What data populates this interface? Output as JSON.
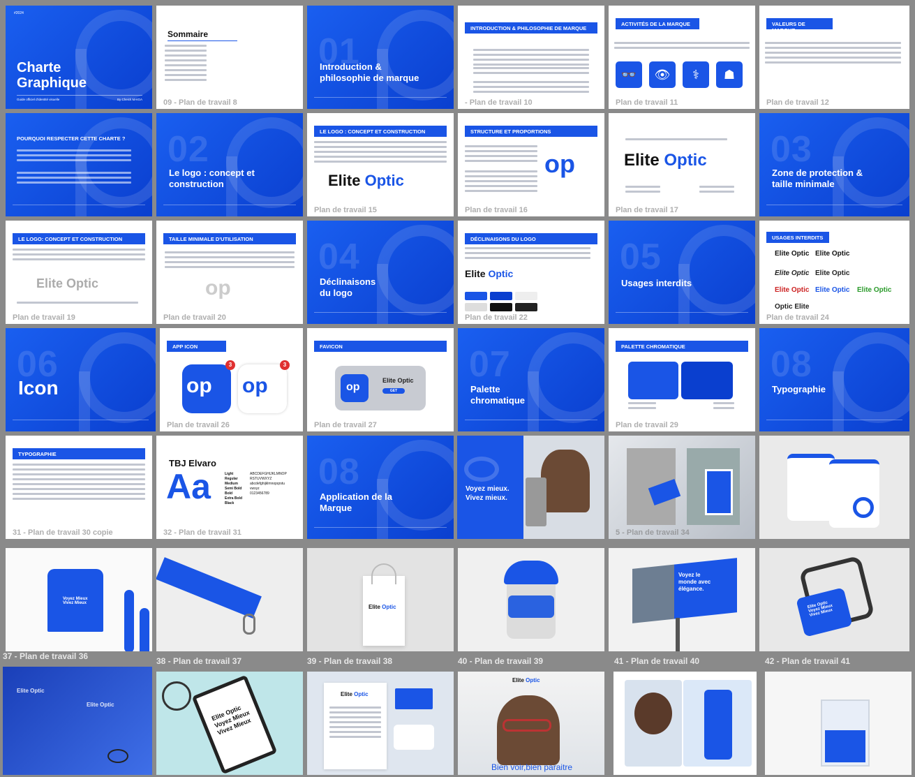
{
  "colors": {
    "canvas": "#8a8a8a",
    "brand_blue": "#1a55e6",
    "brand_dark": "#0a3fcf"
  },
  "brand": {
    "name_part1": "Elite ",
    "name_op": "Optic"
  },
  "b1": {
    "tag": "#2024",
    "title": "Charte\nGraphique",
    "sub": "Guide officiel d'identité visuelle",
    "author": "By Cheick MAIGA"
  },
  "b2": {
    "heading": "Sommaire",
    "label": "09 - Plan de travail 8"
  },
  "b3": {
    "num": "01",
    "title": "Introduction &\nphilosophie de marque"
  },
  "b4": {
    "bar": "INTRODUCTION & PHILOSOPHIE DE MARQUE",
    "label": "- Plan de travail 10"
  },
  "b5": {
    "bar": "ACTIVITÉS DE LA MARQUE",
    "label": "Plan de travail 11"
  },
  "b6": {
    "bar": "VALEURS DE MARQUE",
    "label": "Plan de travail 12"
  },
  "b7": {
    "bar": "POURQUOI RESPECTER CETTE CHARTE ?"
  },
  "b8": {
    "num": "02",
    "title": "Le logo : concept et\nconstruction"
  },
  "b9": {
    "bar": "LE LOGO : CONCEPT ET CONSTRUCTION",
    "label": "Plan de travail 15"
  },
  "b10": {
    "bar": "STRUCTURE ET PROPORTIONS",
    "label": "Plan de travail 16"
  },
  "b11": {
    "label": "Plan de travail 17"
  },
  "b12": {
    "num": "03",
    "title": "Zone de protection &\ntaille minimale"
  },
  "b13": {
    "bar": "LE LOGO: CONCEPT ET CONSTRUCTION",
    "label": "Plan de travail 19"
  },
  "b14": {
    "bar": "TAILLE MINIMALE D'UTILISATION",
    "label": "Plan de travail 20"
  },
  "b15": {
    "num": "04",
    "title": "Déclinaisons\ndu logo"
  },
  "b16": {
    "bar": "DÉCLINAISONS DU LOGO",
    "label": "Plan de travail 22"
  },
  "b17": {
    "num": "05",
    "title": "Usages interdits"
  },
  "b18": {
    "bar": "USAGES INTERDITS",
    "label": "Plan de travail 24"
  },
  "b19": {
    "num": "06",
    "title": "Icon"
  },
  "b20": {
    "bar": "APP ICON",
    "label": "Plan de travail 26",
    "badge": "3"
  },
  "b21": {
    "bar": "FAVICON",
    "label": "Plan de travail 27",
    "app_name": "Elite Optic",
    "get": "GET"
  },
  "b22": {
    "num": "07",
    "title": "Palette\nchromatique"
  },
  "b23": {
    "bar": "PALETTE CHROMATIQUE",
    "label": "Plan de travail 29"
  },
  "b24": {
    "num": "08",
    "title": "Typographie"
  },
  "b25": {
    "bar": "TYPOGRAPHIE",
    "label": "31 - Plan de travail 30 copie"
  },
  "b26": {
    "font": "TBJ Elvaro",
    "aa": "Aa",
    "weights": "Light\nRegular\nMedium\nSemi Bold\nBold\nExtra Bold\nBlack",
    "glyphs": "ABCDEFGHIJKLMNOP\nRSTUVWXYZ\nabcdefghijklmnopqrstu\nvwxyz\n0123456789",
    "label": "32 - Plan de travail 31"
  },
  "b27": {
    "num": "08",
    "title": "Application de la\nMarque"
  },
  "b28": {
    "slogan": "Voyez mieux.\nVivez mieux."
  },
  "b29": {
    "label": "5 - Plan de travail 34"
  },
  "b31": {
    "label": "37 - Plan de travail 36",
    "shirt": "Voyez Mieux\nVivez Mieux"
  },
  "b32": {
    "label": "38 - Plan de travail 37"
  },
  "b33": {
    "label": "39 - Plan de travail 38"
  },
  "b34": {
    "label": "40 - Plan de travail 39"
  },
  "b35": {
    "label": "41 - Plan de travail 40",
    "billboard": "Voyez le\nmonde avec\nélégance."
  },
  "b36": {
    "label": "42 - Plan de travail 41",
    "tag": "Elite Optic\nVoyez Mieux\nVivez Mieux"
  },
  "b38": {
    "clip": "Elite Optic\nVoyez Mieux\nVivez Mieux"
  },
  "b40": {
    "poster": "Bien voir,bien paraitre"
  }
}
